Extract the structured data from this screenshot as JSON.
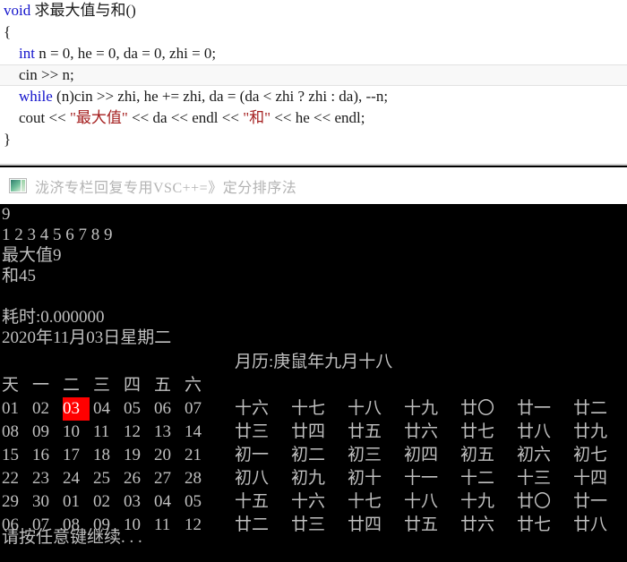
{
  "editor": {
    "lines": [
      {
        "id": "l1",
        "highlight": false,
        "indent": 0,
        "tokens": [
          {
            "t": "kw",
            "s": "void"
          },
          {
            "t": "plain",
            "s": " 求最大值与和()"
          }
        ]
      },
      {
        "id": "l2",
        "highlight": false,
        "indent": 0,
        "tokens": [
          {
            "t": "plain",
            "s": "{"
          }
        ]
      },
      {
        "id": "l3",
        "highlight": false,
        "indent": 1,
        "tokens": [
          {
            "t": "kw",
            "s": "int"
          },
          {
            "t": "plain",
            "s": " n = 0, he = 0, da = 0, zhi = 0;"
          }
        ]
      },
      {
        "id": "l4",
        "highlight": true,
        "indent": 1,
        "tokens": [
          {
            "t": "plain",
            "s": "cin >> n;"
          }
        ]
      },
      {
        "id": "l5",
        "highlight": false,
        "indent": 1,
        "tokens": [
          {
            "t": "kw",
            "s": "while"
          },
          {
            "t": "plain",
            "s": " (n)cin >> zhi, he += zhi, da = (da < zhi ? zhi : da), --n;"
          }
        ]
      },
      {
        "id": "l6",
        "highlight": false,
        "indent": 1,
        "tokens": [
          {
            "t": "plain",
            "s": "cout << "
          },
          {
            "t": "str",
            "s": "\"最大值\""
          },
          {
            "t": "plain",
            "s": " << da << endl << "
          },
          {
            "t": "str",
            "s": "\"和\""
          },
          {
            "t": "plain",
            "s": " << he << endl;"
          }
        ]
      },
      {
        "id": "l7",
        "highlight": false,
        "indent": 0,
        "tokens": [
          {
            "t": "plain",
            "s": "}"
          }
        ]
      }
    ],
    "colors": {
      "background": "#ffffff",
      "text": "#1a1a1a",
      "keyword": "#1414cc",
      "string": "#a52020",
      "highlight_row": "#f8f8f8"
    }
  },
  "watermark": {
    "icon_name": "picture-icon",
    "text": "泷济专栏回复专用VSC++=》定分排序法",
    "color": "#b3b3b3"
  },
  "console": {
    "colors": {
      "background": "#000000",
      "text": "#c0c0c0",
      "today_background": "#ff0000",
      "today_text": "#ffffff"
    },
    "output_lines": [
      {
        "id": "o1",
        "text": "9"
      },
      {
        "id": "o2",
        "text": "1 2 3 4 5 6 7 8 9"
      },
      {
        "id": "o3",
        "text": "最大值9"
      },
      {
        "id": "o4",
        "text": "和45"
      },
      {
        "id": "o5",
        "text": ""
      },
      {
        "id": "o6",
        "text": "耗时:0.000000"
      },
      {
        "id": "o7",
        "text": "2020年11月03日星期二"
      }
    ],
    "calendar": {
      "weekday_headers": [
        "天",
        "一",
        "二",
        "三",
        "四",
        "五",
        "六"
      ],
      "today_value": "03",
      "today_row": 0,
      "today_col": 2,
      "weeks": [
        [
          "01",
          "02",
          "03",
          "04",
          "05",
          "06",
          "07"
        ],
        [
          "08",
          "09",
          "10",
          "11",
          "12",
          "13",
          "14"
        ],
        [
          "15",
          "16",
          "17",
          "18",
          "19",
          "20",
          "21"
        ],
        [
          "22",
          "23",
          "24",
          "25",
          "26",
          "27",
          "28"
        ],
        [
          "29",
          "30",
          "01",
          "02",
          "03",
          "04",
          "05"
        ],
        [
          "06",
          "07",
          "08",
          "09",
          "10",
          "11",
          "12"
        ]
      ]
    },
    "lunar": {
      "header": "月历:庚鼠年九月十八",
      "weeks": [
        [
          "十六",
          "十七",
          "十八",
          "十九",
          "廿〇",
          "廿一",
          "廿二"
        ],
        [
          "廿三",
          "廿四",
          "廿五",
          "廿六",
          "廿七",
          "廿八",
          "廿九"
        ],
        [
          "初一",
          "初二",
          "初三",
          "初四",
          "初五",
          "初六",
          "初七"
        ],
        [
          "初八",
          "初九",
          "初十",
          "十一",
          "十二",
          "十三",
          "十四"
        ],
        [
          "十五",
          "十六",
          "十七",
          "十八",
          "十九",
          "廿〇",
          "廿一"
        ],
        [
          "廿二",
          "廿三",
          "廿四",
          "廿五",
          "廿六",
          "廿七",
          "廿八"
        ]
      ]
    },
    "press_any_key": "请按任意键继续. . ."
  }
}
